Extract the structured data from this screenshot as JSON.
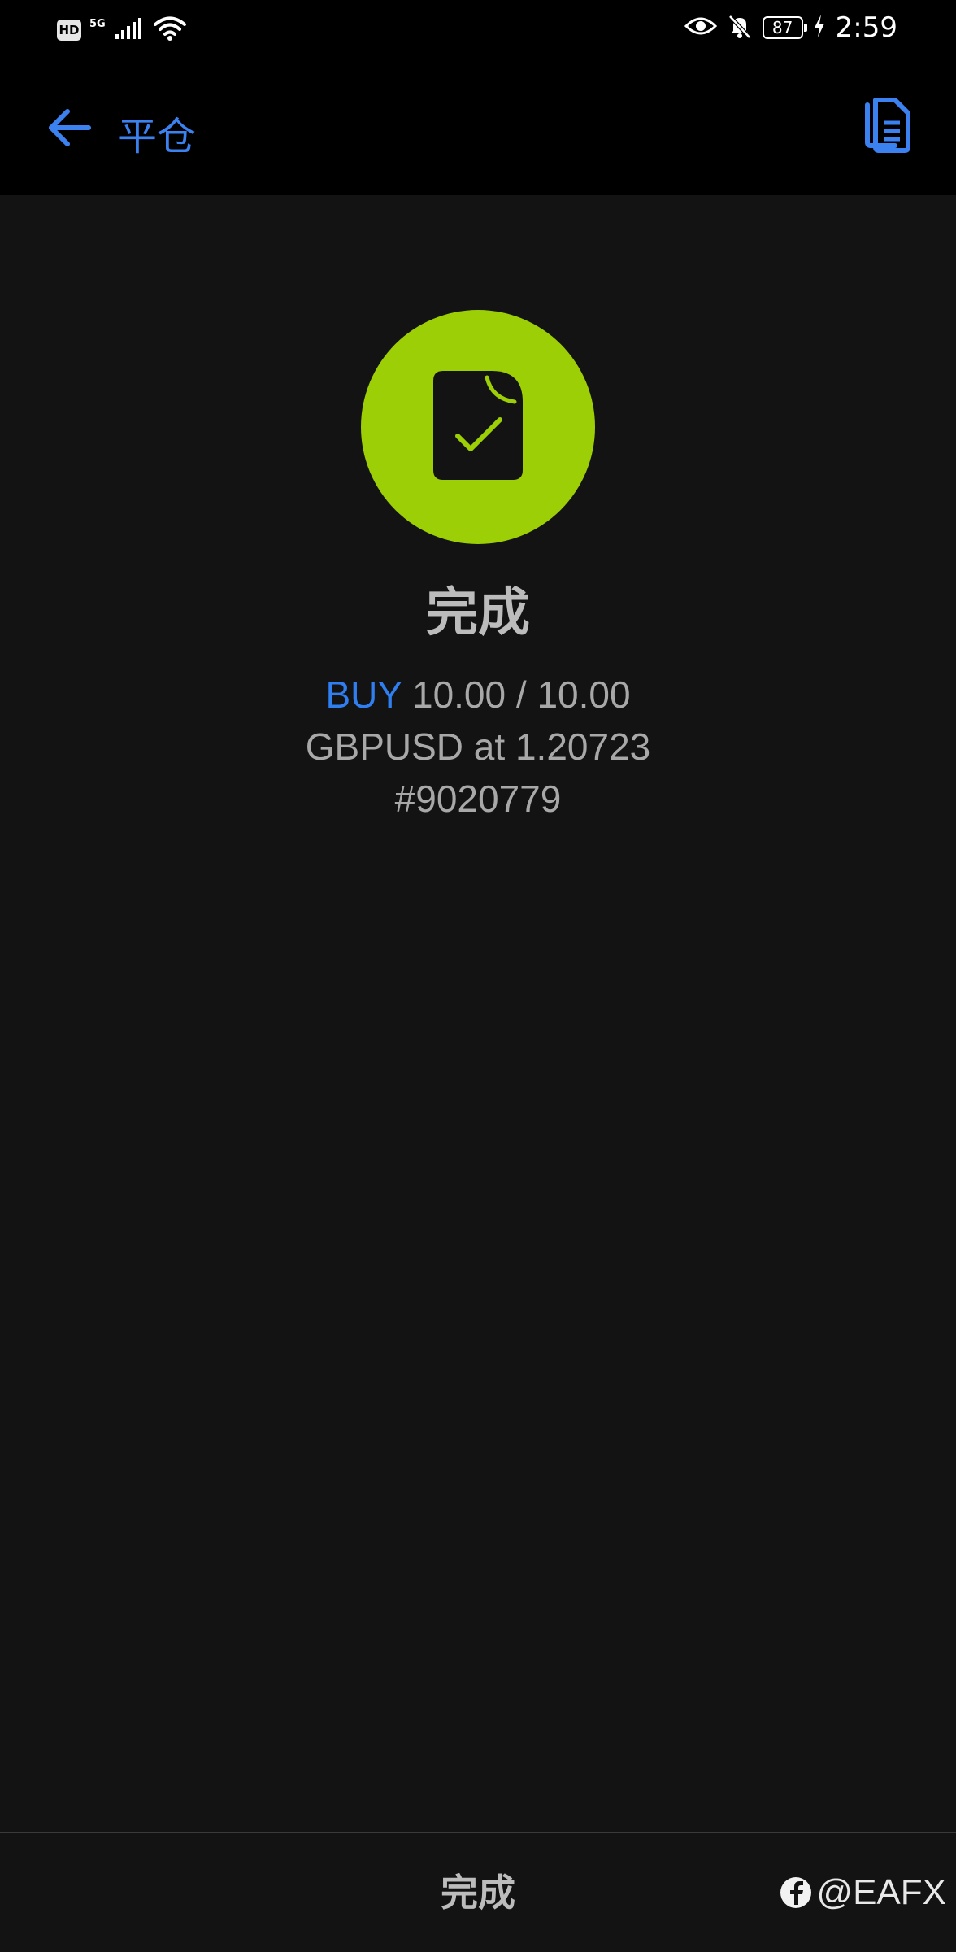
{
  "status_bar": {
    "hd": "HD",
    "network": "5G",
    "battery": "87",
    "time": "2:59"
  },
  "app_bar": {
    "title": "平仓"
  },
  "result": {
    "title": "完成",
    "side": "BUY",
    "volume": "10.00 / 10.00",
    "symbol_line": "GBPUSD at 1.20723",
    "ticket": "#9020779"
  },
  "footer": {
    "done_label": "完成",
    "watermark": "@EAFX"
  },
  "colors": {
    "accent": "#3b82f0",
    "success": "#9ccf06",
    "background": "#131313"
  }
}
